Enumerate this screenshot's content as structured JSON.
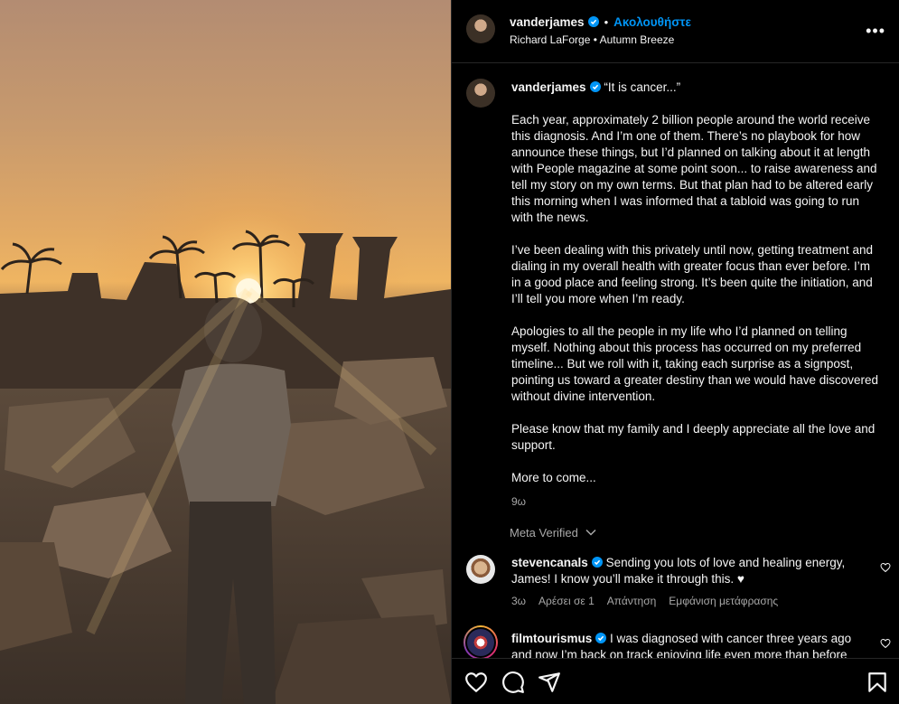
{
  "post": {
    "author": "vanderjames",
    "follow_label": "Ακολουθήστε",
    "audio": "Richard LaForge • Autumn Breeze",
    "more_label": "•••"
  },
  "caption": {
    "author": "vanderjames",
    "opening": "“It is cancer...”",
    "paragraphs": [
      "Each year, approximately 2 billion people around the world receive this diagnosis. And I’m one of them. There’s no playbook for how announce these things, but I’d planned on talking about it at length with People magazine at some point soon... to raise awareness and tell my story on my own terms. But that plan had to be altered early this morning when I was informed that a tabloid was going to run with the news.",
      "I’ve been dealing with this privately until now, getting treatment and dialing in my overall health with greater focus than ever before. I’m in a good place and feeling strong. It’s been quite the initiation, and I’ll tell you more when I’m ready.",
      "Apologies to all the people in my life who I’d planned on telling myself. Nothing about this process has occurred on my preferred timeline... But we roll with it, taking each surprise as a signpost, pointing us toward a greater destiny than we would have discovered without divine intervention.",
      "Please know that my family and I deeply appreciate all the love and support.",
      "More to come..."
    ],
    "time": "9ω",
    "meta_verified": "Meta Verified"
  },
  "comments": [
    {
      "user": "stevencanals",
      "text": "Sending you lots of love and healing energy, James! I know you’ll make it through this. ♥",
      "time": "3ω",
      "likes": "Αρέσει σε 1",
      "reply": "Απάντηση",
      "translate": "Εμφάνιση μετάφρασης"
    },
    {
      "user": "filmtourismus",
      "text": "I was diagnosed with cancer three years ago and now I’m back on track enjoying life even more than before"
    }
  ],
  "colors": {
    "accent": "#0095f6",
    "verified": "#0095f6",
    "secondary_text": "#a8a8a8",
    "border": "#262626"
  },
  "icons": {
    "like": "heart-icon",
    "comment": "comment-icon",
    "share": "share-icon",
    "save": "bookmark-icon"
  }
}
